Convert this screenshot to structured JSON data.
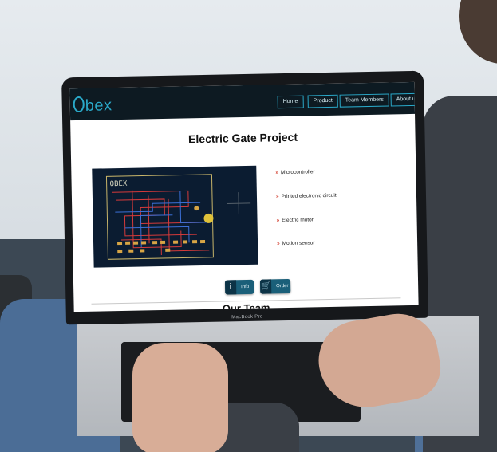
{
  "site": {
    "logo": "bex",
    "nav": [
      "Home",
      "Product",
      "Team Members",
      "About u"
    ],
    "title": "Electric Gate Project",
    "pcb_label": "OBEX",
    "features": [
      "Microcontroller",
      "Printed electronic circuit",
      "Electric motor",
      "Motion sensor"
    ],
    "buttons": {
      "info": "Info",
      "order": "Order",
      "info_icon": "i"
    },
    "next_section": "Our Team"
  },
  "laptop": {
    "model": "MacBook Pro"
  },
  "colors": {
    "nav_bg": "#0d1a22",
    "accent": "#2aa9c9",
    "button": "#1a5f79",
    "bullet": "#d23a2a",
    "pcb_bg": "#0b1c31"
  },
  "icons": {
    "info": "info-icon",
    "cart": "cart-icon",
    "bullet": "chevron-right-icon"
  }
}
